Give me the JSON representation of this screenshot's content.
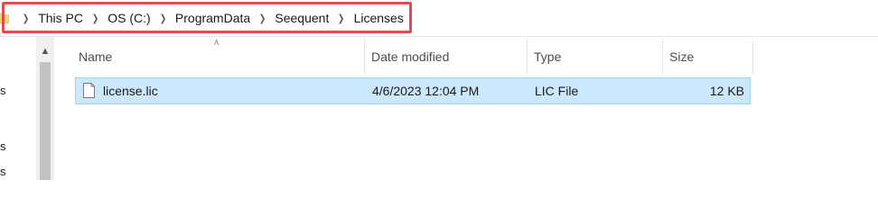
{
  "address": {
    "crumbs": [
      "This PC",
      "OS (C:)",
      "ProgramData",
      "Seequent",
      "Licenses"
    ]
  },
  "nav": {
    "fragments": [
      "s",
      "s",
      "s"
    ]
  },
  "columns": {
    "name": "Name",
    "date_modified": "Date modified",
    "type": "Type",
    "size": "Size"
  },
  "files": [
    {
      "name": "license.lic",
      "date_modified": "4/6/2023 12:04 PM",
      "type": "LIC File",
      "size": "12 KB"
    }
  ],
  "colors": {
    "highlight_border": "#e04b4b",
    "selected_row_bg": "#cce8ff",
    "selected_row_border": "#99d1ff",
    "folder_yellow": "#f8d775"
  },
  "icons": {
    "folder": "folder-icon",
    "chevron": "chevron-right-icon",
    "file": "file-icon",
    "sort": "sort-up-icon"
  }
}
